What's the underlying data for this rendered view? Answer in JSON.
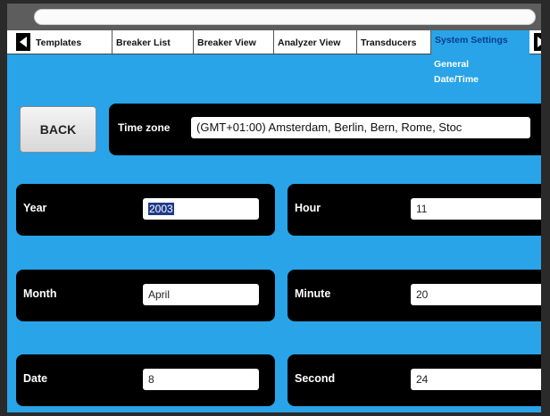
{
  "tabs": {
    "items": [
      "Templates",
      "Breaker List",
      "Breaker View",
      "Analyzer View",
      "Transducers"
    ],
    "active": "System Settings"
  },
  "submenu": {
    "item1": "General",
    "item2": "Date/Time"
  },
  "back": {
    "label": "BACK"
  },
  "timezone": {
    "label": "Time zone",
    "value": "(GMT+01:00) Amsterdam, Berlin, Bern, Rome, Stoc"
  },
  "fields": {
    "year": {
      "label": "Year",
      "value": "2003"
    },
    "month": {
      "label": "Month",
      "value": "April"
    },
    "date": {
      "label": "Date",
      "value": "8"
    },
    "hour": {
      "label": "Hour",
      "value": "11"
    },
    "minute": {
      "label": "Minute",
      "value": "20"
    },
    "second": {
      "label": "Second",
      "value": "24"
    }
  },
  "colors": {
    "screen_bg": "#29a4e8",
    "panel_bg": "#000000",
    "active_tab_text": "#0a3d8f"
  },
  "icons": {
    "prev": "arrow-left-icon",
    "next": "arrow-right-icon"
  }
}
